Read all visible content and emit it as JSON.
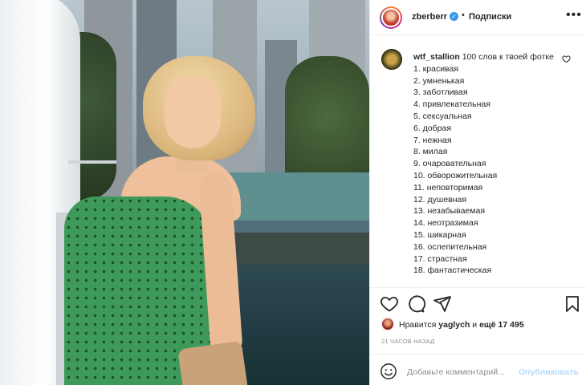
{
  "post_header": {
    "username": "zberberr",
    "separator": "•",
    "follow_label": "Подписки",
    "more_label": "•••"
  },
  "comment": {
    "username": "wtf_stallion",
    "text": "100 слов к твоей фотке",
    "items": [
      "1. красивая",
      "2. умненькая",
      "3. заботливая",
      "4. привлекательная",
      "5. сексуальная",
      "6. добрая",
      "7. нежная",
      "8. милая",
      "9. очаровательная",
      "10. обворожительная",
      "11. неповторимая",
      "12. душевная",
      "13. незабываемая",
      "14. неотразимая",
      "15. шикарная",
      "16. ослепительная",
      "17. страстная",
      "18. фантастическая"
    ]
  },
  "likes": {
    "prefix": "Нравится",
    "user": "yaglych",
    "middle": "и",
    "count": "ещё 17 495"
  },
  "timestamp": "21 ЧАСОВ НАЗАД",
  "add_comment": {
    "placeholder": "Добавьте комментарий...",
    "post_label": "Опубликовать"
  },
  "colors": {
    "text": "#262626",
    "muted": "#8e8e8e",
    "verified": "#3897f0",
    "post_disabled": "#b3dbff",
    "border": "#efefef"
  },
  "icons": [
    "heart-icon",
    "comment-icon",
    "share-icon",
    "bookmark-icon",
    "emoji-icon",
    "verified-icon",
    "more-icon"
  ]
}
